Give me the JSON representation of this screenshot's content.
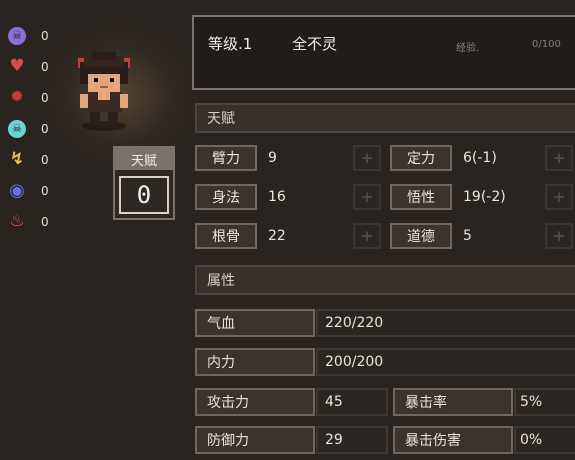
{
  "status_effects": [
    {
      "icon": "purple-skull-icon",
      "color": "#8a6ee0",
      "glyph": "☠",
      "value": "0"
    },
    {
      "icon": "broken-heart-icon",
      "color": "#d94a4a",
      "glyph": "♥",
      "value": "0"
    },
    {
      "icon": "red-virus-icon",
      "color": "#d43a3a",
      "glyph": "✹",
      "value": "0"
    },
    {
      "icon": "cyan-skull-icon",
      "color": "#6ad4d4",
      "glyph": "☠",
      "value": "0"
    },
    {
      "icon": "yellow-lightning-icon",
      "color": "#e4c24a",
      "glyph": "↯",
      "value": "0"
    },
    {
      "icon": "blue-orb-icon",
      "color": "#6a6ee8",
      "glyph": "◉",
      "value": "0"
    },
    {
      "icon": "red-flame-icon",
      "color": "#e0563a",
      "glyph": "♨",
      "value": "0"
    }
  ],
  "talent_points": {
    "label": "天赋",
    "value": "0"
  },
  "header": {
    "level": "等级.1",
    "name": "全不灵",
    "exp_label": "经验.",
    "exp_value": "0/100"
  },
  "sections": {
    "talent": "天赋",
    "attributes": "属性"
  },
  "stats": {
    "strength": {
      "label": "臂力",
      "value": "9"
    },
    "focus": {
      "label": "定力",
      "value": "6(-1)"
    },
    "agility": {
      "label": "身法",
      "value": "16"
    },
    "insight": {
      "label": "悟性",
      "value": "19(-2)"
    },
    "constitution": {
      "label": "根骨",
      "value": "22"
    },
    "morality": {
      "label": "道德",
      "value": "5"
    }
  },
  "attributes": {
    "hp": {
      "label": "气血",
      "value": "220/220"
    },
    "mp": {
      "label": "内力",
      "value": "200/200"
    },
    "attack": {
      "label": "攻击力",
      "value": "45"
    },
    "crit_rate": {
      "label": "暴击率",
      "value": "5%"
    },
    "defense": {
      "label": "防御力",
      "value": "29"
    },
    "crit_damage": {
      "label": "暴击伤害",
      "value": "0%"
    }
  },
  "colors": {
    "background": "#2a2420",
    "panel": "#211c19",
    "border": "#7c746c",
    "text": "#e8dfd3"
  }
}
